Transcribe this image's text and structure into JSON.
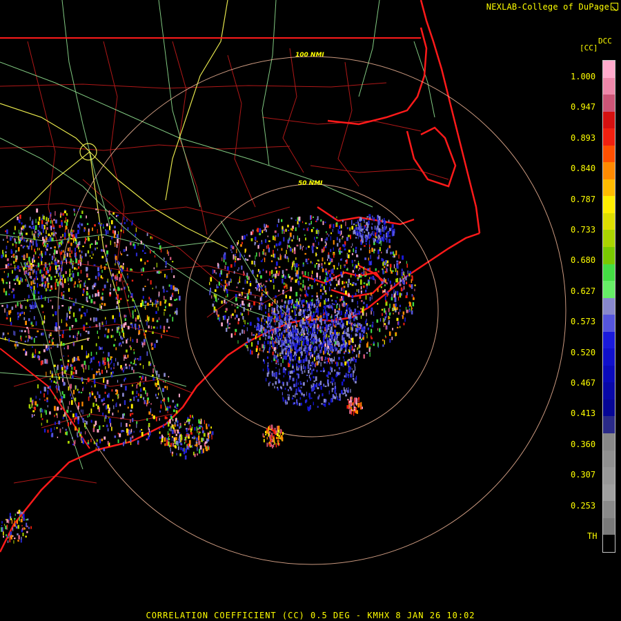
{
  "brand": {
    "text": "NEXLAB-College of DuPage",
    "icon": "external-link-icon"
  },
  "legend": {
    "product_code": "DCC",
    "unit": "[CC]",
    "ticks": [
      "1.000",
      "0.947",
      "0.893",
      "0.840",
      "0.787",
      "0.733",
      "0.680",
      "0.627",
      "0.573",
      "0.520",
      "0.467",
      "0.413",
      "0.360",
      "0.307",
      "0.253",
      "TH"
    ],
    "colors": [
      "#ffaacc",
      "#ee88aa",
      "#cc5577",
      "#d41010",
      "#f02010",
      "#ff5000",
      "#ff8a00",
      "#ffbb00",
      "#ffee00",
      "#dddd00",
      "#aad400",
      "#7ac800",
      "#44dd44",
      "#66ee66",
      "#8888cc",
      "#5555dd",
      "#1a1adc",
      "#1010cc",
      "#0a0abb",
      "#0808a8",
      "#060696",
      "#2a2a88",
      "#888888",
      "#909090",
      "#989898",
      "#a0a0a0",
      "#8a8a8a",
      "#7a7a7a",
      "#000000"
    ]
  },
  "range_rings": [
    "50 NMI",
    "100 NMI"
  ],
  "colors": {
    "coastline": "#ff1a1a",
    "county_lines": "#b01818",
    "highways": "#99ee99",
    "interstates": "#ffff55",
    "range_rings": "#ffc0a0",
    "text": "#ffff00"
  },
  "title": "CORRELATION COEFFICIENT (CC) 0.5 DEG - KMHX 8 JAN 26 10:02"
}
